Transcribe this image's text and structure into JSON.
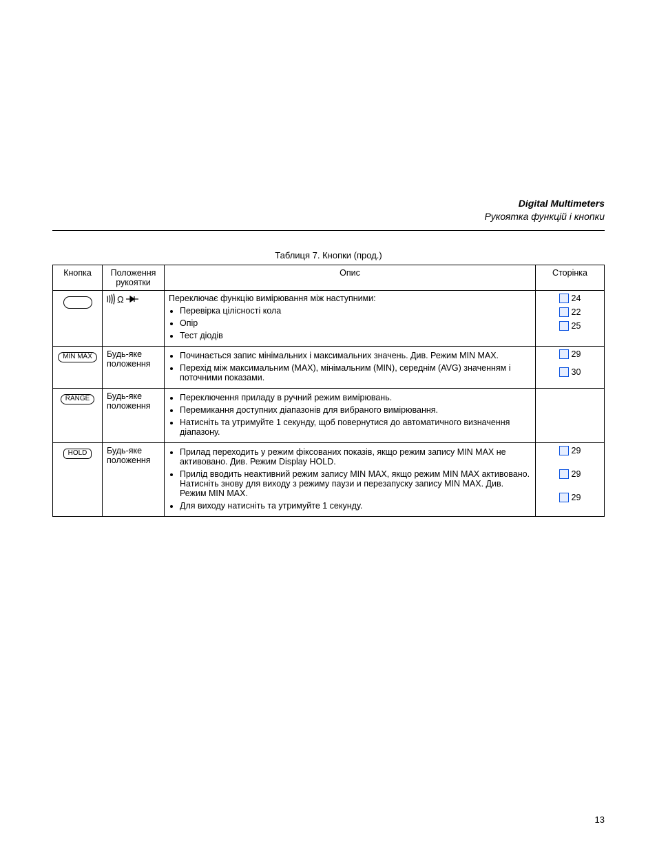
{
  "header": {
    "title": "Digital Multimeters",
    "subtitle": "Рукоятка функцій і кнопки"
  },
  "table": {
    "caption": "Таблиця 7. Кнопки (прод.)",
    "columns": [
      "Кнопка",
      "Положення рукоятки",
      "Опис",
      "Сторінка"
    ],
    "rows": [
      {
        "button": "blank",
        "position_glyphs": "G |e R",
        "desc_lead": "Переключає функцію вимірювання між наступними:",
        "desc_items": [
          "Перевірка цілісності кола",
          "Опір",
          "Тест діодів"
        ],
        "pages": [
          {
            "num": "24"
          },
          {
            "num": "22"
          },
          {
            "num": "25"
          }
        ]
      },
      {
        "button": "minmax",
        "button_label": "MIN MAX",
        "position": "Будь-яке положення",
        "desc_items": [
          "Починається запис мінімальних і максимальних значень. Див. Режим MIN MAX.",
          "Перехід між максимальним (MAX), мінімальним (MIN), середнім (AVG) значенням і поточними показами."
        ],
        "pages": [
          {
            "num": "29"
          },
          {
            "num": "30"
          }
        ]
      },
      {
        "button": "range",
        "button_label": "RANGE",
        "position": "Будь-яке положення",
        "desc_items": [
          "Переключення приладу в ручний режим вимірювань.",
          "Перемикання доступних діапазонів для вибраного вимірювання.",
          "Натисніть та утримуйте 1 секунду, щоб повернутися до автоматичного визначення діапазону."
        ],
        "pages": []
      },
      {
        "button": "hold",
        "button_label": "HOLD",
        "position": "Будь-яке положення",
        "desc_items": [
          "Прилад переходить у режим фіксованих показів, якщо режим запису MIN MAX не активовано. Див. Режим Display HOLD.",
          "Прилід вводить неактивний режим запису MIN MAX, якщо режим MIN MAX активовано. Натисніть знову для виходу з режиму паузи и перезапуску запису MIN MAX. Див. Режим MIN MAX.",
          "Для виходу натисніть та утримуйте 1 секунду."
        ],
        "pages": [
          {
            "num": "29"
          },
          {
            "num": "29"
          },
          {
            "num": "29"
          }
        ]
      }
    ]
  },
  "footer": {
    "page": "13"
  }
}
